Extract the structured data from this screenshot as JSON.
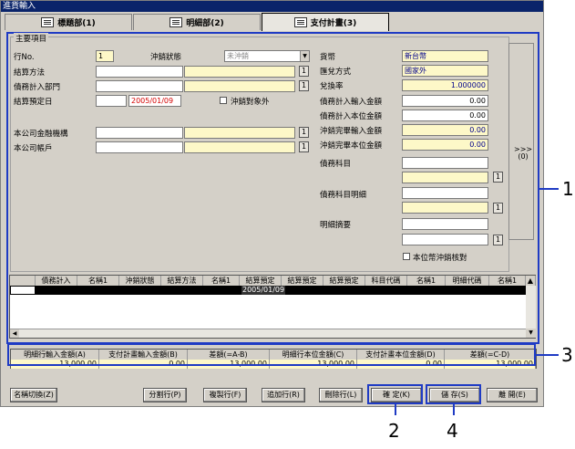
{
  "window": {
    "title": "進貨輸入"
  },
  "tabs": [
    {
      "label": "標題部(1)"
    },
    {
      "label": "明細部(2)"
    },
    {
      "label": "支付計畫(3)"
    }
  ],
  "section": {
    "title": "主要項目"
  },
  "form": {
    "row_no_label": "行No.",
    "row_no_value": "1",
    "offset_status_label": "沖銷狀態",
    "offset_status_value": "未沖銷",
    "settle_method_label": "結算方法",
    "debt_dept_label": "債務計入部門",
    "settle_date_label": "結算預定日",
    "settle_date_value": "2005/01/09",
    "offset_exclude_label": "沖銷對象外",
    "company_bank_label": "本公司金融機構",
    "company_account_label": "本公司帳戶",
    "currency_label": "貨幣",
    "currency_value": "新台幣",
    "remit_method_label": "匯兌方式",
    "remit_method_value": "國家外",
    "exchange_rate_label": "兌換率",
    "exchange_rate_value": "1.000000",
    "debt_input_amount_label": "債務計入輸入金額",
    "debt_input_amount_value": "0.00",
    "debt_base_amount_label": "債務計入本位金額",
    "debt_base_amount_value": "0.00",
    "offset_input_amount_label": "沖銷完畢輸入金額",
    "offset_input_amount_value": "0.00",
    "offset_base_amount_label": "沖銷完畢本位金額",
    "offset_base_amount_value": "0.00",
    "debt_subject_label": "債務科目",
    "debt_subject_detail_label": "債務科目明細",
    "detail_summary_label": "明細摘要",
    "base_currency_offset_label": "本位幣沖銷核對",
    "lookup_btn": "1",
    "side_button": ">>> (0)"
  },
  "grid": {
    "columns": [
      "債務計入",
      "名稱1",
      "沖銷狀態",
      "結算方法",
      "名稱1",
      "結算預定",
      "結算預定",
      "結算預定",
      "科目代碼",
      "名稱1",
      "明細代碼",
      "名稱1"
    ],
    "row1_date": "2005/01/09"
  },
  "summary": {
    "headers": [
      "明細行輸入金額(A)",
      "支付計畫輸入金額(B)",
      "差額(=A-B)",
      "明細行本位金額(C)",
      "支付計畫本位金額(D)",
      "差額(=C-D)"
    ],
    "values": [
      "13,000.00",
      "0.00",
      "13,000.00",
      "13,000.00",
      "0.00",
      "13,000.00"
    ]
  },
  "buttons": {
    "name_switch": "名稱切換(Z)",
    "split_row": "分割行(P)",
    "copy_row": "複製行(F)",
    "add_row": "追加行(R)",
    "delete_row": "刪除行(L)",
    "confirm": "確 定(K)",
    "save": "儲 存(S)",
    "close": "離 開(E)"
  },
  "callouts": [
    "1",
    "2",
    "3",
    "4"
  ],
  "colors": {
    "highlight": "#1f3bc4",
    "title_bar": "#0a246a",
    "field_yellow": "#fdf8c8"
  }
}
